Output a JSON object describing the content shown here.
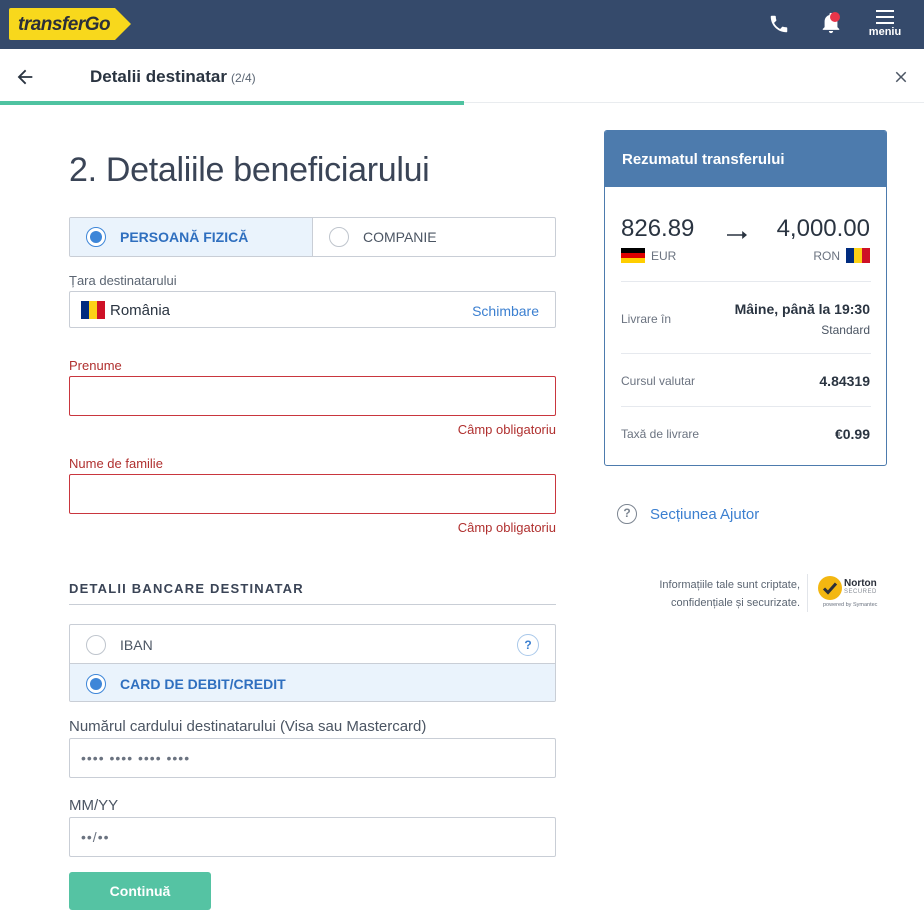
{
  "topbar": {
    "logo": "transferGo",
    "menu_label": "meniu",
    "icons": [
      "phone-icon",
      "bell-icon",
      "hamburger-icon"
    ]
  },
  "step": {
    "title": "Detalii destinatar",
    "count": "(2/4)",
    "progress": 0.5
  },
  "form": {
    "heading": "2. Detaliile beneficiarului",
    "recipient_type": {
      "options": [
        "PERSOANĂ FIZICĂ",
        "COMPANIE"
      ],
      "selected": "PERSOANĂ FIZICĂ"
    },
    "country": {
      "label": "Țara destinatarului",
      "value": "România",
      "change_label": "Schimbare"
    },
    "first_name": {
      "label": "Prenume",
      "value": "",
      "error": "Câmp obligatoriu"
    },
    "last_name": {
      "label": "Nume de familie",
      "value": "",
      "error": "Câmp obligatoriu"
    },
    "bank_section_title": "DETALII BANCARE DESTINATAR",
    "bank_method": {
      "options": [
        "IBAN",
        "CARD DE DEBIT/CREDIT"
      ],
      "selected": "CARD DE DEBIT/CREDIT",
      "help_glyph": "?"
    },
    "card_number": {
      "label": "Numărul cardului destinatarului (Visa sau Mastercard)",
      "placeholder": "•••• •••• •••• ••••"
    },
    "expiry": {
      "label": "MM/YY",
      "placeholder": "••/••"
    },
    "continue_label": "Continuă"
  },
  "summary": {
    "title": "Rezumatul transferului",
    "send_amount": "826.89",
    "send_currency": "EUR",
    "receive_amount": "4,000.00",
    "receive_currency": "RON",
    "delivery_label": "Livrare în",
    "delivery_value": "Mâine, până la 19:30",
    "delivery_type": "Standard",
    "rate_label": "Cursul valutar",
    "rate_value": "4.84319",
    "fee_label": "Taxă de livrare",
    "fee_value": "€0.99"
  },
  "help": {
    "glyph": "?",
    "label": "Secțiunea Ajutor"
  },
  "security": {
    "line1": "Informațiile tale sunt criptate,",
    "line2": "confidențiale și securizate.",
    "badge_name": "Norton",
    "badge_sub": "SECURED",
    "badge_by": "powered by Symantec"
  },
  "colors": {
    "nav_bg": "#354a6b",
    "logo_yellow": "#f8d81c",
    "accent_blue": "#3e86d8",
    "progress_green": "#4fc3a1",
    "button_green": "#55c3a3",
    "error_red": "#b0302f",
    "summary_header": "#4d7bad"
  }
}
